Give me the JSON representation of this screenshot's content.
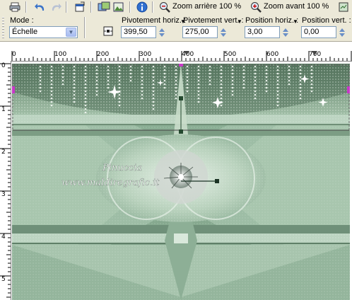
{
  "toolbar_top": {
    "zoom_out_label": "Zoom arrière 100 %",
    "zoom_in_label": "Zoom avant 100 %"
  },
  "tool_options": {
    "mode": {
      "label": "Mode :",
      "value": "Échelle"
    },
    "pivot_horiz": {
      "label": "Pivotement horiz. :",
      "value": "399,50"
    },
    "pivot_vert": {
      "label": "Pivotement vert. :",
      "value": "275,00"
    },
    "position_horiz": {
      "label": "Position horiz. :",
      "value": "3,00"
    },
    "position_vert": {
      "label": "Position vert. :",
      "value": "0,00"
    }
  },
  "ruler": {
    "horizontal_labels": [
      "0",
      "100",
      "200",
      "300",
      "400",
      "500",
      "600",
      "700"
    ],
    "vertical_labels": [
      "0",
      "1",
      "2",
      "3",
      "4",
      "5"
    ]
  },
  "canvas": {
    "watermark_line1": "Pinuccia",
    "watermark_line2": "www.maldiregrafic.it",
    "palette": {
      "background": "#9dbda5",
      "dark": "#4f6d58",
      "light": "#d7e8da",
      "frame": "#bcd4c1"
    }
  }
}
